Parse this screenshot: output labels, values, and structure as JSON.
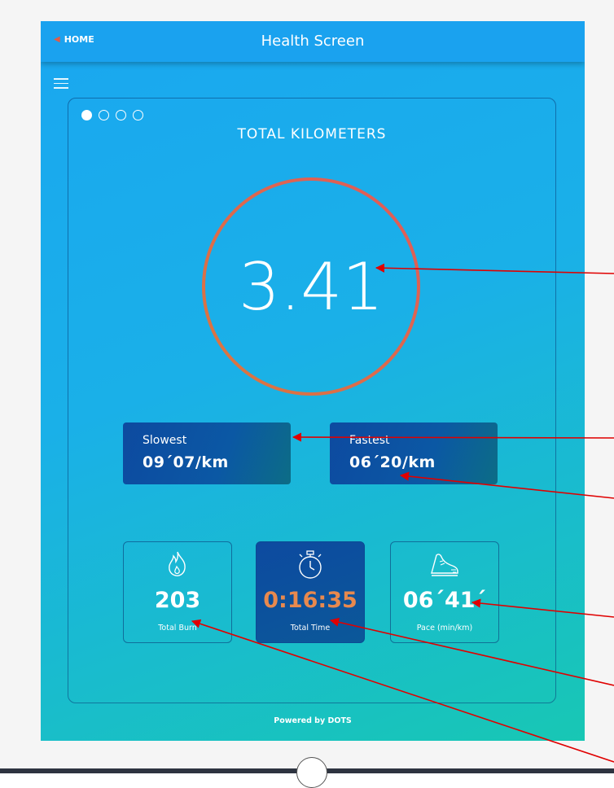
{
  "header": {
    "back_label": "HOME",
    "title": "Health Screen"
  },
  "card": {
    "title": "TOTAL KILOMETERS",
    "pager": {
      "total": 4,
      "active_index": 0
    },
    "distance_value": "3.41",
    "ring_colors": [
      "#d9783f",
      "#e05a5a"
    ]
  },
  "stats": {
    "slowest": {
      "label": "Slowest",
      "value": "09´07/km"
    },
    "fastest": {
      "label": "Fastest",
      "value": "06´20/km"
    }
  },
  "metrics": [
    {
      "icon": "flame-icon",
      "value": "203",
      "caption": "Total Burn"
    },
    {
      "icon": "stopwatch-icon",
      "value": "0:16:35",
      "caption": "Total Time"
    },
    {
      "icon": "running-shoe-icon",
      "value": "06´41´",
      "caption": "Pace (min/km)"
    }
  ],
  "footer": {
    "text": "Powered by DOTS"
  },
  "annotation_color": "#e00000"
}
